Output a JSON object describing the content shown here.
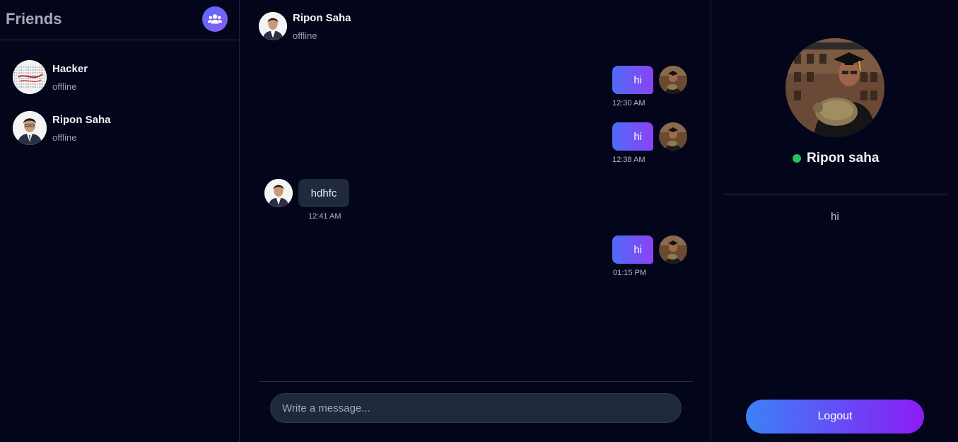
{
  "sidebar": {
    "title": "Friends",
    "friends_icon": "users-icon",
    "friends": [
      {
        "name": "Hacker",
        "status": "offline"
      },
      {
        "name": "Ripon Saha",
        "status": "offline"
      }
    ]
  },
  "chat": {
    "contact_name": "Ripon Saha",
    "contact_status": "offline",
    "messages": [
      {
        "direction": "out",
        "text": "hi",
        "time": "12:30 AM"
      },
      {
        "direction": "out",
        "text": "hi",
        "time": "12:38 AM"
      },
      {
        "direction": "in",
        "text": "hdhfc",
        "time": "12:41 AM"
      },
      {
        "direction": "out",
        "text": "hi",
        "time": "01:15 PM"
      }
    ],
    "composer_placeholder": "Write a message..."
  },
  "profile": {
    "name": "Ripon saha",
    "online_color": "#22c55e",
    "bio": "hi",
    "logout_label": "Logout"
  },
  "colors": {
    "background": "#03051b",
    "accent_start": "#4f6bf7",
    "accent_end": "#8a43f5",
    "incoming_bubble": "#1f2a3c"
  }
}
